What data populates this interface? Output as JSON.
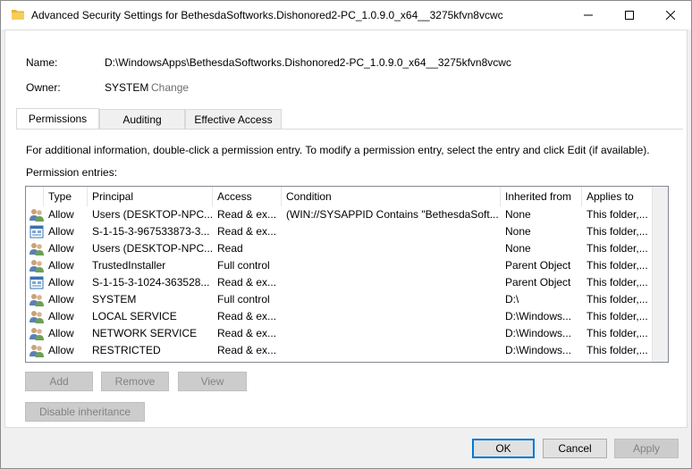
{
  "window": {
    "title": "Advanced Security Settings for BethesdaSoftworks.Dishonored2-PC_1.0.9.0_x64__3275kfvn8vcwc"
  },
  "details": {
    "name_label": "Name:",
    "name_value": "D:\\WindowsApps\\BethesdaSoftworks.Dishonored2-PC_1.0.9.0_x64__3275kfvn8vcwc",
    "owner_label": "Owner:",
    "owner_value": "SYSTEM",
    "change_link": "Change"
  },
  "tabs": [
    {
      "label": "Permissions",
      "active": true
    },
    {
      "label": "Auditing",
      "active": false
    },
    {
      "label": "Effective Access",
      "active": false
    }
  ],
  "permissions": {
    "info_text": "For additional information, double-click a permission entry. To modify a permission entry, select the entry and click Edit (if available).",
    "entries_label": "Permission entries:",
    "columns": [
      "Type",
      "Principal",
      "Access",
      "Condition",
      "Inherited from",
      "Applies to"
    ],
    "rows": [
      {
        "icon": "users-icon",
        "type": "Allow",
        "principal": "Users (DESKTOP-NPC...",
        "access": "Read & ex...",
        "condition": "(WIN://SYSAPPID Contains \"BethesdaSoft...",
        "inherited": "None",
        "applies": "This folder,..."
      },
      {
        "icon": "app-sid-icon",
        "type": "Allow",
        "principal": "S-1-15-3-967533873-3...",
        "access": "Read & ex...",
        "condition": "",
        "inherited": "None",
        "applies": "This folder,..."
      },
      {
        "icon": "users-icon",
        "type": "Allow",
        "principal": "Users (DESKTOP-NPC...",
        "access": "Read",
        "condition": "",
        "inherited": "None",
        "applies": "This folder,..."
      },
      {
        "icon": "users-icon",
        "type": "Allow",
        "principal": "TrustedInstaller",
        "access": "Full control",
        "condition": "",
        "inherited": "Parent Object",
        "applies": "This folder,..."
      },
      {
        "icon": "app-sid-icon",
        "type": "Allow",
        "principal": "S-1-15-3-1024-363528...",
        "access": "Read & ex...",
        "condition": "",
        "inherited": "Parent Object",
        "applies": "This folder,..."
      },
      {
        "icon": "users-icon",
        "type": "Allow",
        "principal": "SYSTEM",
        "access": "Full control",
        "condition": "",
        "inherited": "D:\\",
        "applies": "This folder,..."
      },
      {
        "icon": "users-icon",
        "type": "Allow",
        "principal": "LOCAL SERVICE",
        "access": "Read & ex...",
        "condition": "",
        "inherited": "D:\\Windows...",
        "applies": "This folder,..."
      },
      {
        "icon": "users-icon",
        "type": "Allow",
        "principal": "NETWORK SERVICE",
        "access": "Read & ex...",
        "condition": "",
        "inherited": "D:\\Windows...",
        "applies": "This folder,..."
      },
      {
        "icon": "users-icon",
        "type": "Allow",
        "principal": "RESTRICTED",
        "access": "Read & ex...",
        "condition": "",
        "inherited": "D:\\Windows...",
        "applies": "This folder,..."
      }
    ]
  },
  "buttons": {
    "add": "Add",
    "remove": "Remove",
    "view": "View",
    "disable_inheritance": "Disable inheritance",
    "ok": "OK",
    "cancel": "Cancel",
    "apply": "Apply"
  }
}
